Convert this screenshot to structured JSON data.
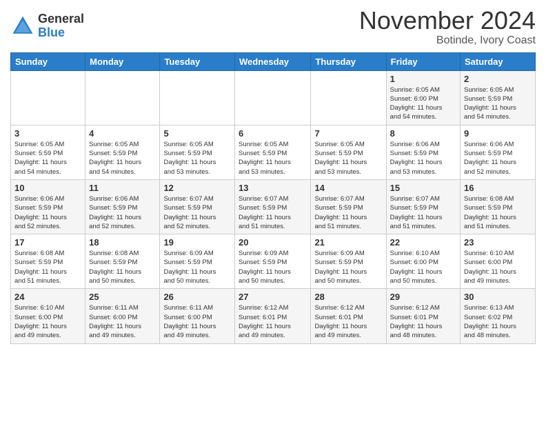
{
  "header": {
    "logo_general": "General",
    "logo_blue": "Blue",
    "month_title": "November 2024",
    "location": "Botinde, Ivory Coast"
  },
  "days_of_week": [
    "Sunday",
    "Monday",
    "Tuesday",
    "Wednesday",
    "Thursday",
    "Friday",
    "Saturday"
  ],
  "weeks": [
    {
      "row_bg": "light",
      "days": [
        {
          "num": "",
          "info": ""
        },
        {
          "num": "",
          "info": ""
        },
        {
          "num": "",
          "info": ""
        },
        {
          "num": "",
          "info": ""
        },
        {
          "num": "",
          "info": ""
        },
        {
          "num": "1",
          "info": "Sunrise: 6:05 AM\nSunset: 6:00 PM\nDaylight: 11 hours\nand 54 minutes."
        },
        {
          "num": "2",
          "info": "Sunrise: 6:05 AM\nSunset: 5:59 PM\nDaylight: 11 hours\nand 54 minutes."
        }
      ]
    },
    {
      "row_bg": "dark",
      "days": [
        {
          "num": "3",
          "info": "Sunrise: 6:05 AM\nSunset: 5:59 PM\nDaylight: 11 hours\nand 54 minutes."
        },
        {
          "num": "4",
          "info": "Sunrise: 6:05 AM\nSunset: 5:59 PM\nDaylight: 11 hours\nand 54 minutes."
        },
        {
          "num": "5",
          "info": "Sunrise: 6:05 AM\nSunset: 5:59 PM\nDaylight: 11 hours\nand 53 minutes."
        },
        {
          "num": "6",
          "info": "Sunrise: 6:05 AM\nSunset: 5:59 PM\nDaylight: 11 hours\nand 53 minutes."
        },
        {
          "num": "7",
          "info": "Sunrise: 6:05 AM\nSunset: 5:59 PM\nDaylight: 11 hours\nand 53 minutes."
        },
        {
          "num": "8",
          "info": "Sunrise: 6:06 AM\nSunset: 5:59 PM\nDaylight: 11 hours\nand 53 minutes."
        },
        {
          "num": "9",
          "info": "Sunrise: 6:06 AM\nSunset: 5:59 PM\nDaylight: 11 hours\nand 52 minutes."
        }
      ]
    },
    {
      "row_bg": "light",
      "days": [
        {
          "num": "10",
          "info": "Sunrise: 6:06 AM\nSunset: 5:59 PM\nDaylight: 11 hours\nand 52 minutes."
        },
        {
          "num": "11",
          "info": "Sunrise: 6:06 AM\nSunset: 5:59 PM\nDaylight: 11 hours\nand 52 minutes."
        },
        {
          "num": "12",
          "info": "Sunrise: 6:07 AM\nSunset: 5:59 PM\nDaylight: 11 hours\nand 52 minutes."
        },
        {
          "num": "13",
          "info": "Sunrise: 6:07 AM\nSunset: 5:59 PM\nDaylight: 11 hours\nand 51 minutes."
        },
        {
          "num": "14",
          "info": "Sunrise: 6:07 AM\nSunset: 5:59 PM\nDaylight: 11 hours\nand 51 minutes."
        },
        {
          "num": "15",
          "info": "Sunrise: 6:07 AM\nSunset: 5:59 PM\nDaylight: 11 hours\nand 51 minutes."
        },
        {
          "num": "16",
          "info": "Sunrise: 6:08 AM\nSunset: 5:59 PM\nDaylight: 11 hours\nand 51 minutes."
        }
      ]
    },
    {
      "row_bg": "dark",
      "days": [
        {
          "num": "17",
          "info": "Sunrise: 6:08 AM\nSunset: 5:59 PM\nDaylight: 11 hours\nand 51 minutes."
        },
        {
          "num": "18",
          "info": "Sunrise: 6:08 AM\nSunset: 5:59 PM\nDaylight: 11 hours\nand 50 minutes."
        },
        {
          "num": "19",
          "info": "Sunrise: 6:09 AM\nSunset: 5:59 PM\nDaylight: 11 hours\nand 50 minutes."
        },
        {
          "num": "20",
          "info": "Sunrise: 6:09 AM\nSunset: 5:59 PM\nDaylight: 11 hours\nand 50 minutes."
        },
        {
          "num": "21",
          "info": "Sunrise: 6:09 AM\nSunset: 5:59 PM\nDaylight: 11 hours\nand 50 minutes."
        },
        {
          "num": "22",
          "info": "Sunrise: 6:10 AM\nSunset: 6:00 PM\nDaylight: 11 hours\nand 50 minutes."
        },
        {
          "num": "23",
          "info": "Sunrise: 6:10 AM\nSunset: 6:00 PM\nDaylight: 11 hours\nand 49 minutes."
        }
      ]
    },
    {
      "row_bg": "light",
      "days": [
        {
          "num": "24",
          "info": "Sunrise: 6:10 AM\nSunset: 6:00 PM\nDaylight: 11 hours\nand 49 minutes."
        },
        {
          "num": "25",
          "info": "Sunrise: 6:11 AM\nSunset: 6:00 PM\nDaylight: 11 hours\nand 49 minutes."
        },
        {
          "num": "26",
          "info": "Sunrise: 6:11 AM\nSunset: 6:00 PM\nDaylight: 11 hours\nand 49 minutes."
        },
        {
          "num": "27",
          "info": "Sunrise: 6:12 AM\nSunset: 6:01 PM\nDaylight: 11 hours\nand 49 minutes."
        },
        {
          "num": "28",
          "info": "Sunrise: 6:12 AM\nSunset: 6:01 PM\nDaylight: 11 hours\nand 49 minutes."
        },
        {
          "num": "29",
          "info": "Sunrise: 6:12 AM\nSunset: 6:01 PM\nDaylight: 11 hours\nand 48 minutes."
        },
        {
          "num": "30",
          "info": "Sunrise: 6:13 AM\nSunset: 6:02 PM\nDaylight: 11 hours\nand 48 minutes."
        }
      ]
    }
  ]
}
